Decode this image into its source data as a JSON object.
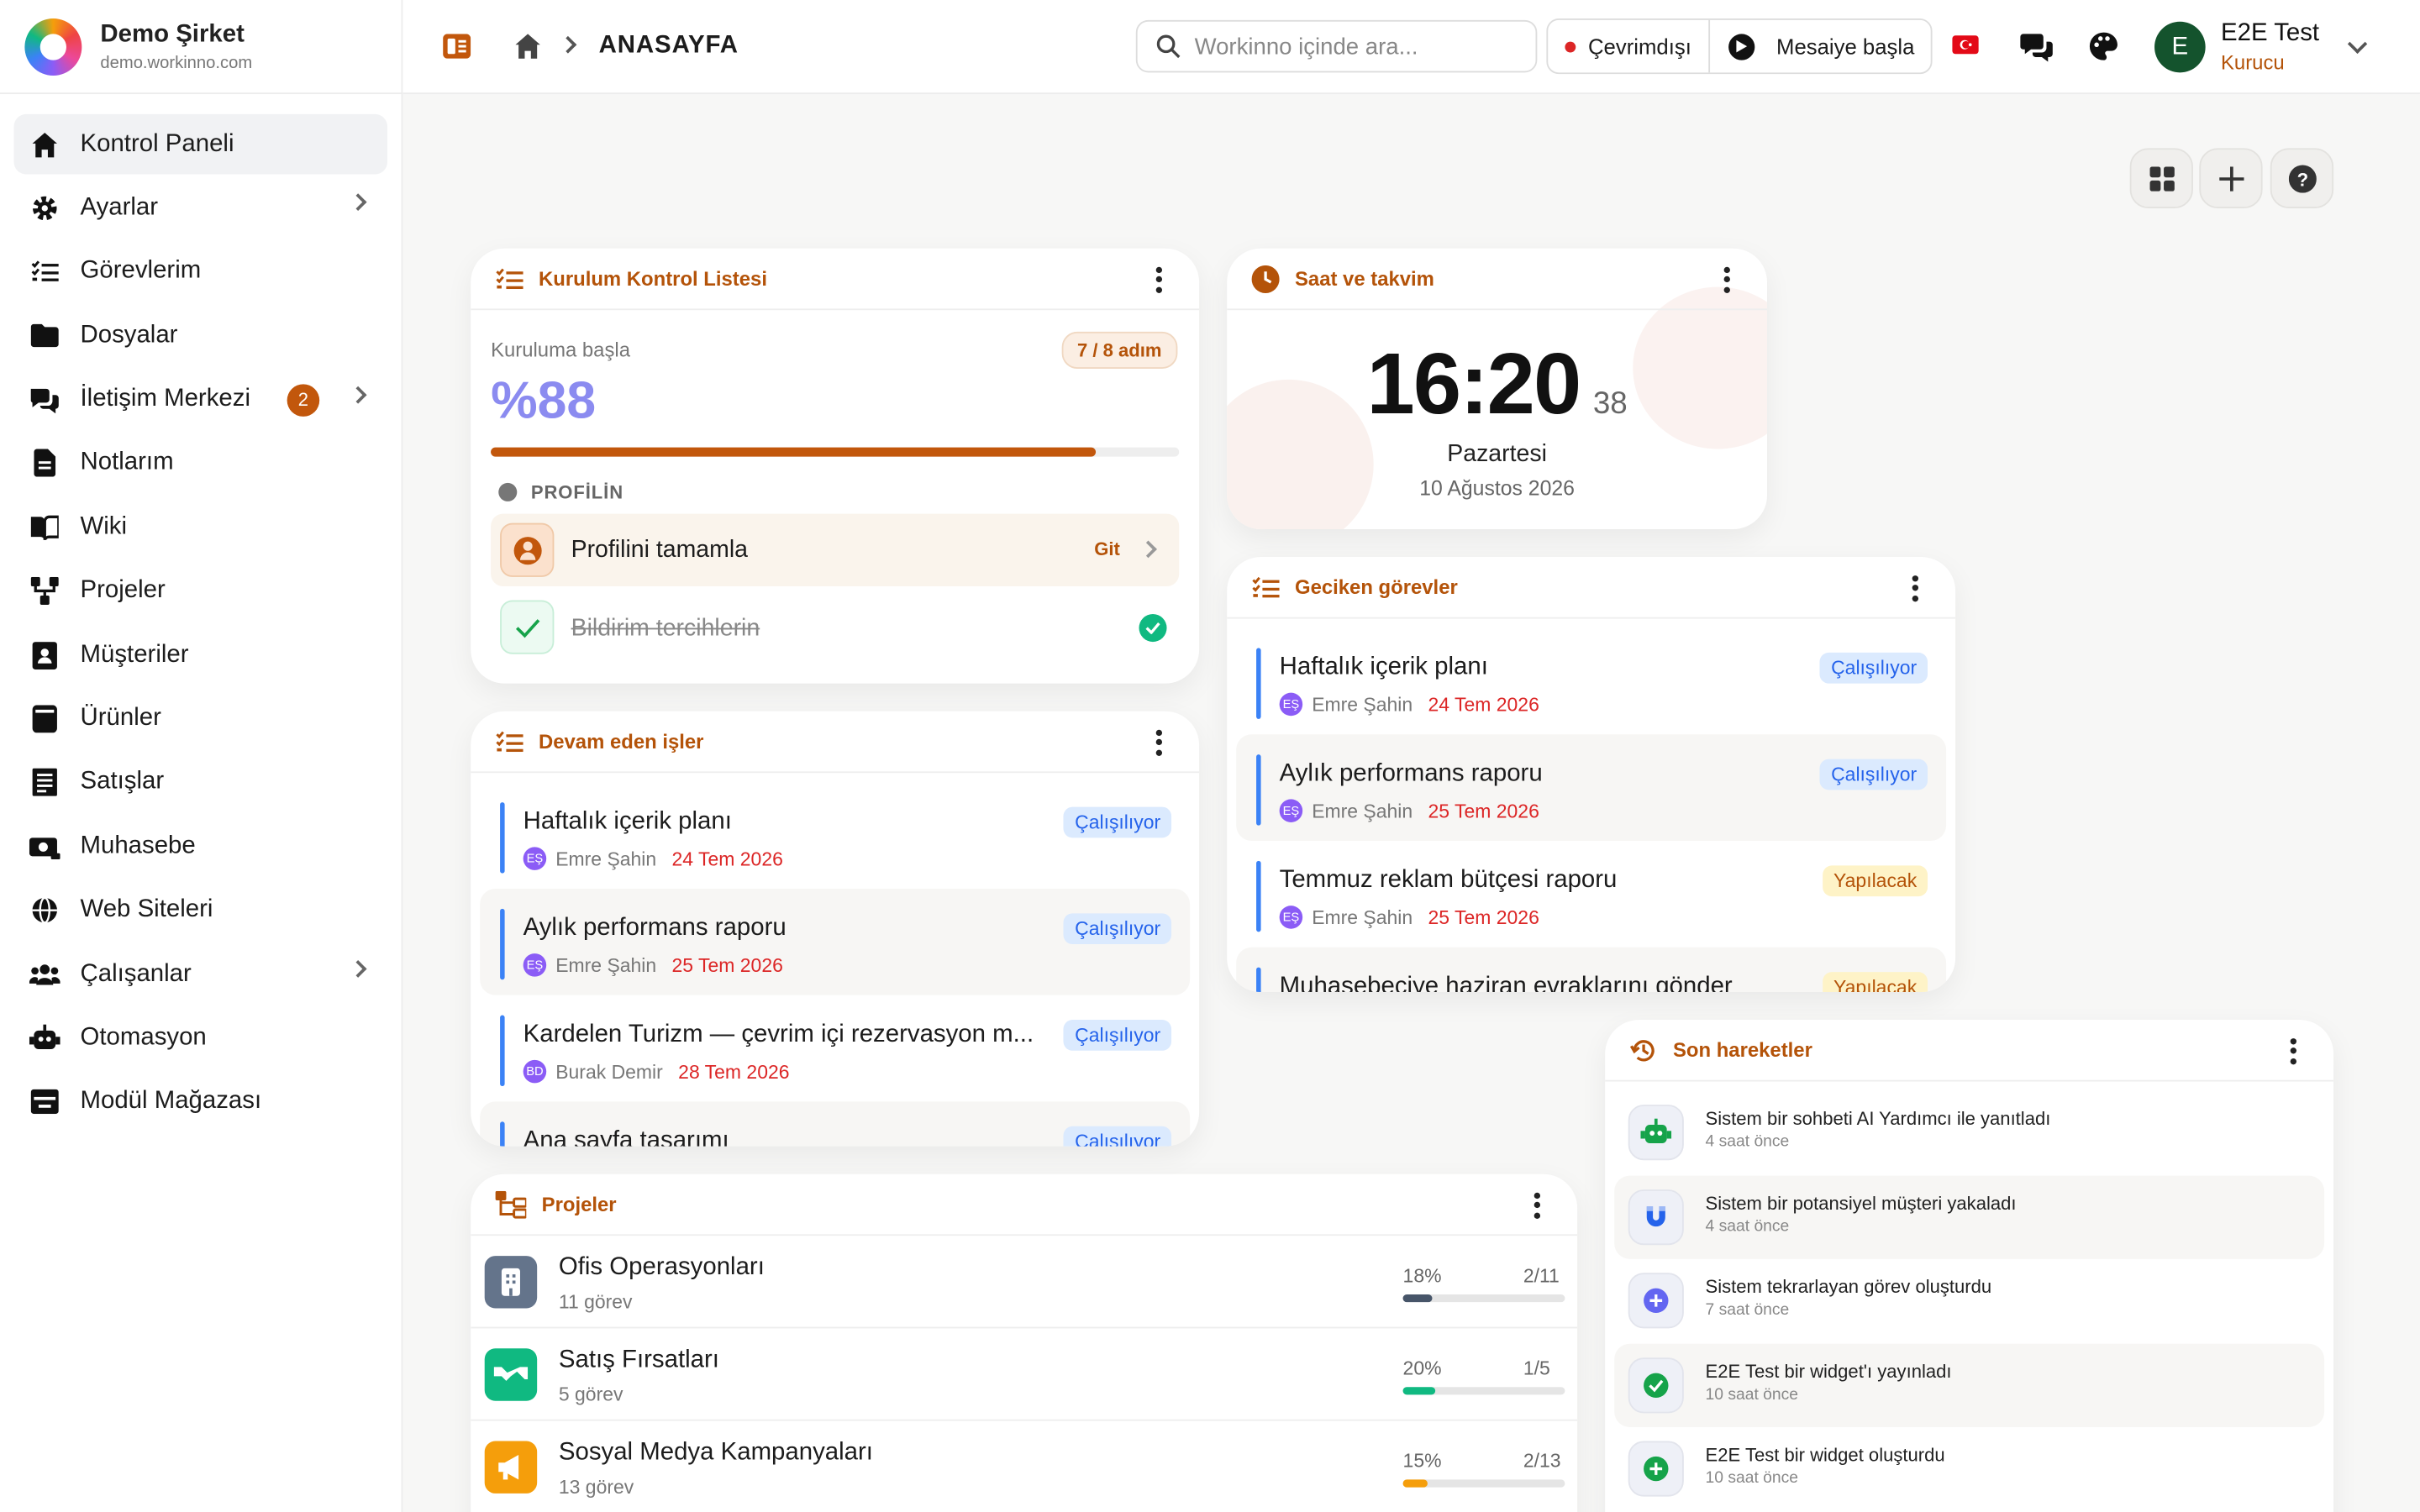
{
  "brand": {
    "name": "Demo Şirket",
    "url": "demo.workinno.com"
  },
  "sidebar": {
    "items": [
      {
        "label": "Kontrol Paneli",
        "icon": "home-icon",
        "active": true
      },
      {
        "label": "Ayarlar",
        "icon": "gear-icon",
        "chevron": true
      },
      {
        "label": "Görevlerim",
        "icon": "checklist-icon"
      },
      {
        "label": "Dosyalar",
        "icon": "folder-icon"
      },
      {
        "label": "İletişim Merkezi",
        "icon": "chat-icon",
        "badge": "2",
        "chevron": true
      },
      {
        "label": "Notlarım",
        "icon": "note-icon"
      },
      {
        "label": "Wiki",
        "icon": "book-icon"
      },
      {
        "label": "Projeler",
        "icon": "project-icon"
      },
      {
        "label": "Müşteriler",
        "icon": "contact-icon"
      },
      {
        "label": "Ürünler",
        "icon": "box-icon"
      },
      {
        "label": "Satışlar",
        "icon": "receipt-icon"
      },
      {
        "label": "Muhasebe",
        "icon": "money-icon"
      },
      {
        "label": "Web Siteleri",
        "icon": "globe-icon"
      },
      {
        "label": "Çalışanlar",
        "icon": "people-icon",
        "chevron": true
      },
      {
        "label": "Otomasyon",
        "icon": "robot-icon"
      },
      {
        "label": "Modül Mağazası",
        "icon": "store-icon"
      }
    ]
  },
  "topbar": {
    "breadcrumb": "ANASAYFA",
    "search_placeholder": "Workinno içinde ara...",
    "status": "Çevrimdışı",
    "shift": "Mesaiye başla",
    "user_name": "E2E Test",
    "user_role": "Kurucu",
    "user_initial": "E"
  },
  "setup": {
    "title": "Kurulum Kontrol Listesi",
    "start": "Kuruluma başla",
    "steps": "7 / 8 adım",
    "percent": "%88",
    "progress": 0.88,
    "section": "PROFİLİN",
    "item1": "Profilini tamamla",
    "item1_action": "Git",
    "item2": "Bildirim tercihlerin"
  },
  "clock": {
    "title": "Saat ve takvim",
    "time": "16:20",
    "seconds": "38",
    "day": "Pazartesi",
    "date": "10 Ağustos 2026"
  },
  "ongoing": {
    "title": "Devam eden işler",
    "tasks": [
      {
        "title": "Haftalık içerik planı",
        "initials": "EŞ",
        "person": "Emre Şahin",
        "due": "24 Tem 2026",
        "status": "Çalışılıyor",
        "kind": "work"
      },
      {
        "title": "Aylık performans raporu",
        "initials": "EŞ",
        "person": "Emre Şahin",
        "due": "25 Tem 2026",
        "status": "Çalışılıyor",
        "kind": "work"
      },
      {
        "title": "Kardelen Turizm — çevrim içi rezervasyon m...",
        "initials": "BD",
        "person": "Burak Demir",
        "due": "28 Tem 2026",
        "status": "Çalışılıyor",
        "kind": "work"
      },
      {
        "title": "Ana sayfa tasarımı",
        "initials": "",
        "person": "",
        "due": "",
        "status": "Çalışılıyor",
        "kind": "work"
      }
    ]
  },
  "overdue": {
    "title": "Geciken görevler",
    "tasks": [
      {
        "title": "Haftalık içerik planı",
        "initials": "EŞ",
        "person": "Emre Şahin",
        "due": "24 Tem 2026",
        "status": "Çalışılıyor",
        "kind": "work"
      },
      {
        "title": "Aylık performans raporu",
        "initials": "EŞ",
        "person": "Emre Şahin",
        "due": "25 Tem 2026",
        "status": "Çalışılıyor",
        "kind": "work"
      },
      {
        "title": "Temmuz reklam bütçesi raporu",
        "initials": "EŞ",
        "person": "Emre Şahin",
        "due": "25 Tem 2026",
        "status": "Yapılacak",
        "kind": "todo"
      },
      {
        "title": "Muhasebeciye haziran evraklarını gönder",
        "initials": "",
        "person": "",
        "due": "",
        "status": "Yapılacak",
        "kind": "todo"
      }
    ]
  },
  "projects": {
    "title": "Projeler",
    "items": [
      {
        "name": "Ofis Operasyonları",
        "count": "11 görev",
        "percent": "18%",
        "frac": "2/11",
        "progress": 0.18,
        "color": "#64748b",
        "barcolor": "#475569",
        "icon": "building-icon"
      },
      {
        "name": "Satış Fırsatları",
        "count": "5 görev",
        "percent": "20%",
        "frac": "1/5",
        "progress": 0.2,
        "color": "#10b981",
        "barcolor": "#10b981",
        "icon": "handshake-icon"
      },
      {
        "name": "Sosyal Medya Kampanyaları",
        "count": "13 görev",
        "percent": "15%",
        "frac": "2/13",
        "progress": 0.15,
        "color": "#f59e0b",
        "barcolor": "#f59e0b",
        "icon": "megaphone-icon"
      }
    ]
  },
  "activity": {
    "title": "Son hareketler",
    "items": [
      {
        "text": "Sistem bir sohbeti AI Yardımcı ile yanıtladı",
        "time": "4 saat önce",
        "icon": "robot-icon",
        "color": "#16a34a"
      },
      {
        "text": "Sistem bir potansiyel müşteri yakaladı",
        "time": "4 saat önce",
        "icon": "magnet-icon",
        "color": "#2563eb"
      },
      {
        "text": "Sistem tekrarlayan görev oluşturdu",
        "time": "7 saat önce",
        "icon": "plus-circle-icon",
        "color": "#6366f1"
      },
      {
        "text": "E2E Test bir widget'ı yayınladı",
        "time": "10 saat önce",
        "icon": "check-circle-icon",
        "color": "#16a34a"
      },
      {
        "text": "E2E Test bir widget oluşturdu",
        "time": "10 saat önce",
        "icon": "plus-circle-icon",
        "color": "#16a34a"
      }
    ]
  },
  "colors": {
    "accent": "#b45309",
    "progress": "#c2570c",
    "percent_text": "#8b8bf0"
  }
}
